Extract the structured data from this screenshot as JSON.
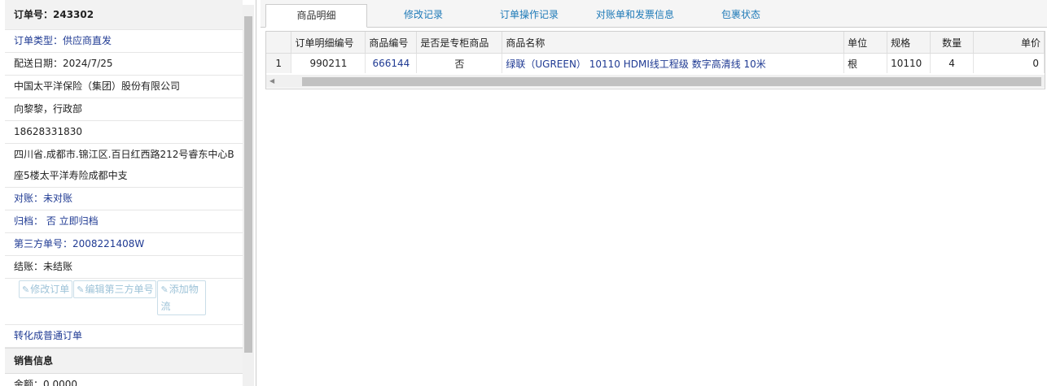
{
  "sidebar": {
    "order_no": "订单号：243302",
    "order_type": "订单类型：供应商直发",
    "delivery_date": "配送日期：2024/7/25",
    "company": "中国太平洋保险（集团）股份有限公司",
    "contact": "向黎黎，行政部",
    "phone": "18628331830",
    "address": "四川省.成都市.锦江区.百日红西路212号睿东中心B座5楼太平洋寿险成都中支",
    "reconcile": "对账：未对账",
    "archive": "归档： 否 立即归档",
    "third_party_no": "第三方单号：2008221408W",
    "settle": "结账：未结账",
    "buttons": {
      "edit_order": "修改订单",
      "edit_third": "编辑第三方单号",
      "add_logistics": "添加物流"
    },
    "convert": "转化成普通订单",
    "sales_section": "销售信息",
    "amount": "金额：0.0000"
  },
  "tabs": [
    {
      "label": "商品明细",
      "active": true
    },
    {
      "label": "修改记录",
      "active": false
    },
    {
      "label": "订单操作记录",
      "active": false
    },
    {
      "label": "对账单和发票信息",
      "active": false
    },
    {
      "label": "包裹状态",
      "active": false
    }
  ],
  "table": {
    "headers": [
      "",
      "订单明细编号",
      "商品编号",
      "是否是专柜商品",
      "商品名称",
      "单位",
      "规格",
      "数量",
      "单价"
    ],
    "rows": [
      [
        "1",
        "990211",
        "666144",
        "否",
        "绿联（UGREEN） 10110 HDMI线工程级 数字高清线 10米",
        "根",
        "10110",
        "4",
        "0"
      ]
    ]
  },
  "icons": {
    "edit": "edit-icon"
  },
  "colors": {
    "link": "#1f3a93",
    "tab_link": "#1e7ab8",
    "disabled_button": "#9ec3d8"
  }
}
